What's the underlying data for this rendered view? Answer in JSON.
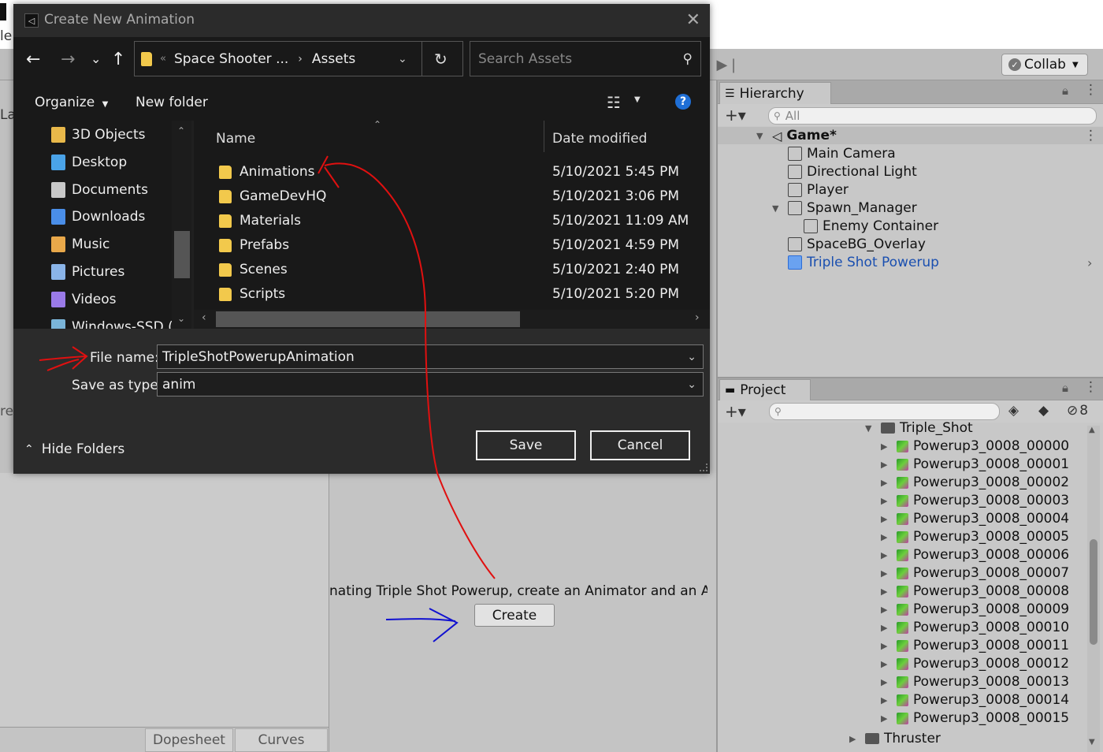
{
  "unity": {
    "collab_label": "Collab",
    "hierarchy": {
      "tab_label": "Hierarchy",
      "search_placeholder": "All",
      "scene": "Game*",
      "items": [
        {
          "label": "Main Camera",
          "depth": 1,
          "arrow": ""
        },
        {
          "label": "Directional Light",
          "depth": 1,
          "arrow": ""
        },
        {
          "label": "Player",
          "depth": 1,
          "arrow": ""
        },
        {
          "label": "Spawn_Manager",
          "depth": 1,
          "arrow": "down"
        },
        {
          "label": "Enemy Container",
          "depth": 2,
          "arrow": ""
        },
        {
          "label": "SpaceBG_Overlay",
          "depth": 1,
          "arrow": ""
        },
        {
          "label": "Triple Shot Powerup",
          "depth": 1,
          "arrow": "",
          "selected": true
        }
      ]
    },
    "project": {
      "tab_label": "Project",
      "hidden_count": "8",
      "folder": "Triple_Shot",
      "items": [
        "Powerup3_0008_00000",
        "Powerup3_0008_00001",
        "Powerup3_0008_00002",
        "Powerup3_0008_00003",
        "Powerup3_0008_00004",
        "Powerup3_0008_00005",
        "Powerup3_0008_00006",
        "Powerup3_0008_00007",
        "Powerup3_0008_00008",
        "Powerup3_0008_00009",
        "Powerup3_0008_00010",
        "Powerup3_0008_00011",
        "Powerup3_0008_00012",
        "Powerup3_0008_00013",
        "Powerup3_0008_00014",
        "Powerup3_0008_00015"
      ],
      "next_folder": "Thruster"
    },
    "animation": {
      "message": "nating Triple Shot Powerup, create an Animator and an A",
      "create_label": "Create",
      "tabs": [
        "Dopesheet",
        "Curves"
      ]
    },
    "left_edge": {
      "top_text": "le",
      "side1": "La",
      "side2": "re"
    }
  },
  "dialog": {
    "title": "Create New Animation",
    "breadcrumb": [
      "Space Shooter ...",
      "Assets"
    ],
    "search_placeholder": "Search Assets",
    "organize_label": "Organize",
    "new_folder_label": "New folder",
    "nav_items": [
      {
        "label": "3D Objects",
        "icon": "3d-objects-icon",
        "color": "#e8b84a"
      },
      {
        "label": "Desktop",
        "icon": "desktop-icon",
        "color": "#4aa3e8"
      },
      {
        "label": "Documents",
        "icon": "documents-icon",
        "color": "#c8c8c8"
      },
      {
        "label": "Downloads",
        "icon": "downloads-icon",
        "color": "#4a8ee8"
      },
      {
        "label": "Music",
        "icon": "music-icon",
        "color": "#e8a84a"
      },
      {
        "label": "Pictures",
        "icon": "pictures-icon",
        "color": "#8ab4e8"
      },
      {
        "label": "Videos",
        "icon": "videos-icon",
        "color": "#9a7ae8"
      },
      {
        "label": "Windows-SSD (C",
        "icon": "drive-icon",
        "color": "#7ab4d8"
      }
    ],
    "columns": {
      "name": "Name",
      "date": "Date modified"
    },
    "files": [
      {
        "name": "Animations",
        "date": "5/10/2021 5:45 PM"
      },
      {
        "name": "GameDevHQ",
        "date": "5/10/2021 3:06 PM"
      },
      {
        "name": "Materials",
        "date": "5/10/2021 11:09 AM"
      },
      {
        "name": "Prefabs",
        "date": "5/10/2021 4:59 PM"
      },
      {
        "name": "Scenes",
        "date": "5/10/2021 2:40 PM"
      },
      {
        "name": "Scripts",
        "date": "5/10/2021 5:20 PM"
      }
    ],
    "file_name_label": "File name:",
    "file_name_value": "TripleShotPowerupAnimation",
    "save_type_label": "Save as type:",
    "save_type_value": "anim",
    "hide_folders_label": "Hide Folders",
    "save_label": "Save",
    "cancel_label": "Cancel"
  }
}
